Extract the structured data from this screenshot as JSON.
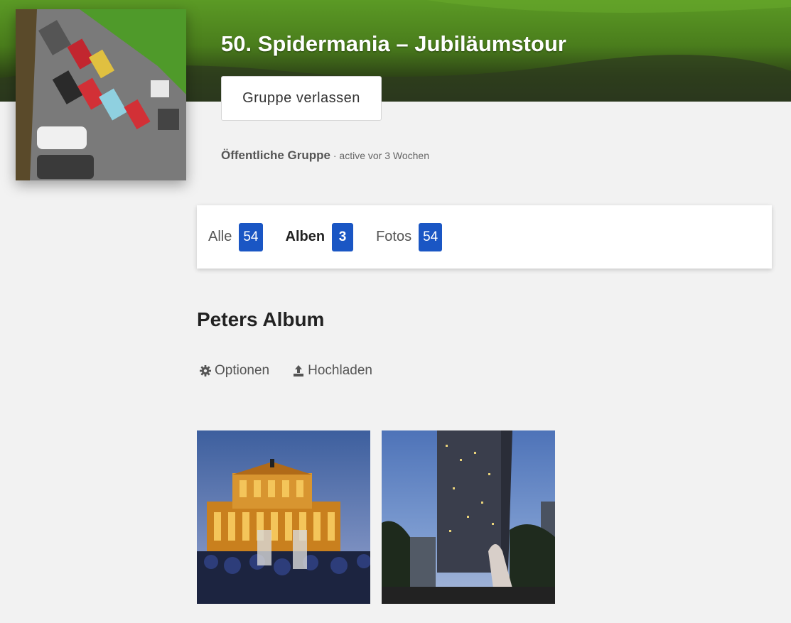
{
  "group": {
    "title": "50. Spidermania – Jubiläumstour",
    "leave_label": "Gruppe verlassen",
    "type": "Öffentliche Gruppe",
    "activity": " · active vor 3 Wochen"
  },
  "tabs": [
    {
      "label": "Alle",
      "count": "54",
      "active": false
    },
    {
      "label": "Alben",
      "count": "3",
      "active": true
    },
    {
      "label": "Fotos",
      "count": "54",
      "active": false
    }
  ],
  "album": {
    "title": "Peters Album",
    "options_label": "Optionen",
    "upload_label": "Hochladen"
  },
  "photos": [
    {
      "subject": "opera-house-night"
    },
    {
      "subject": "skyscraper-dusk"
    }
  ],
  "colors": {
    "accent": "#1a56c4",
    "background": "#f2f2f2"
  }
}
